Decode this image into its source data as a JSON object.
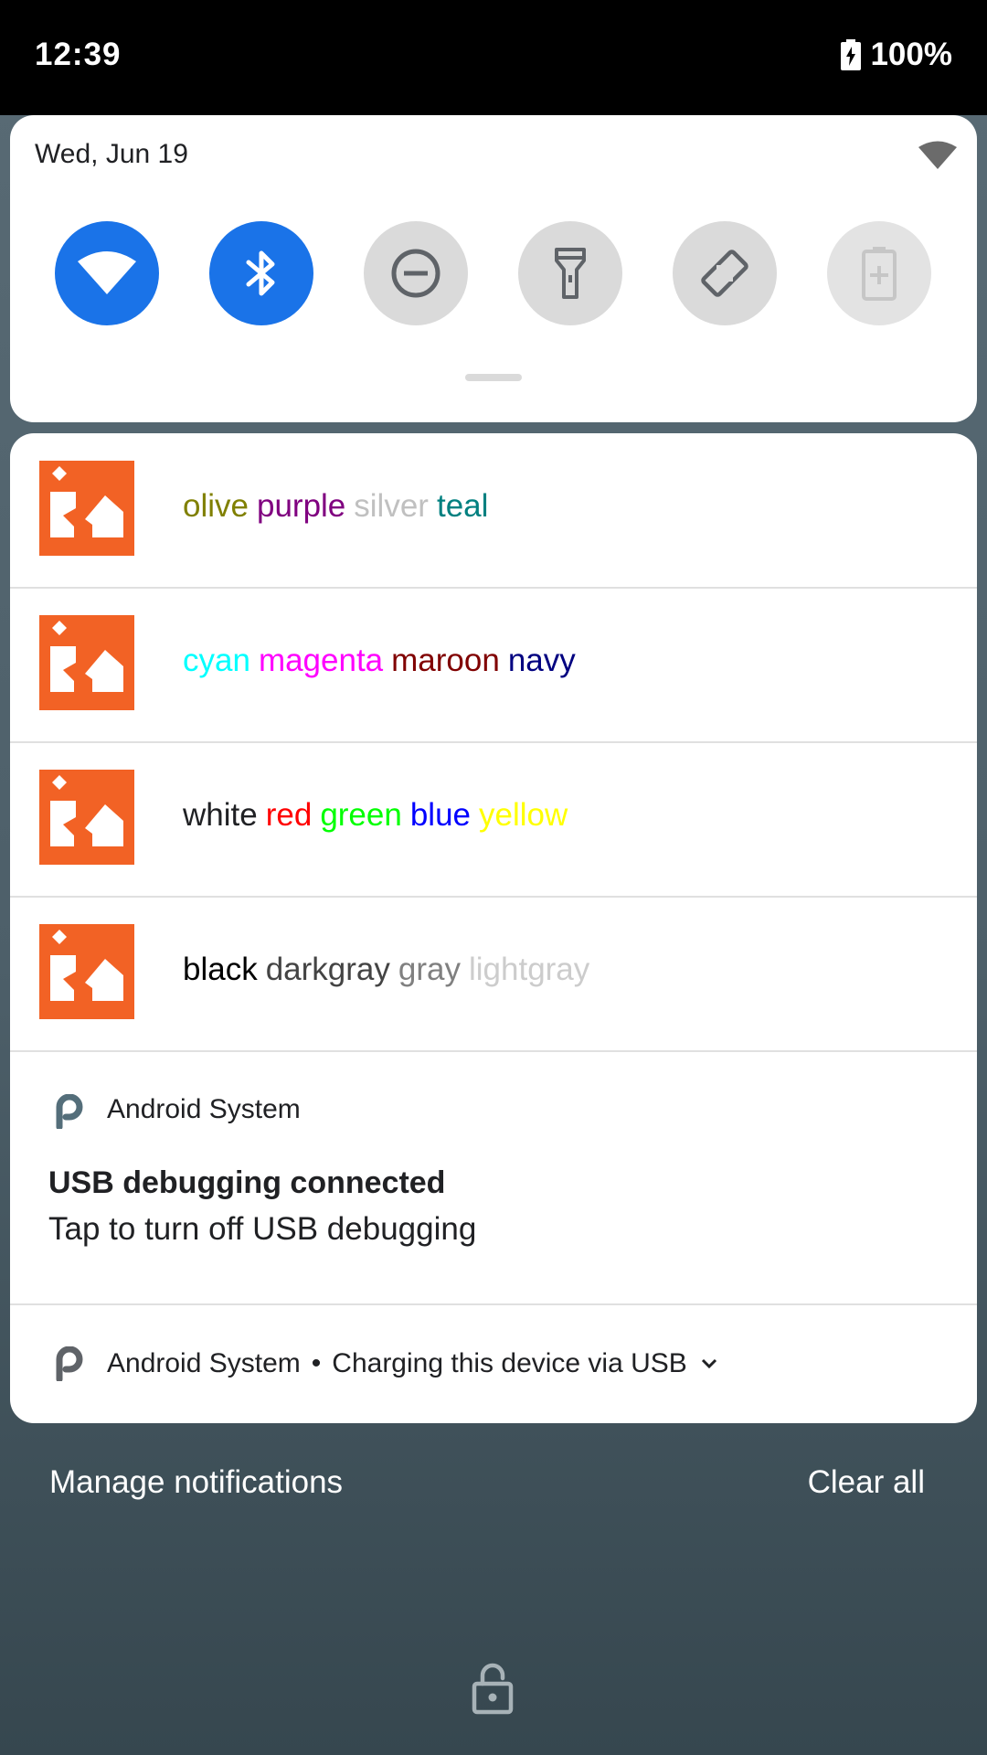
{
  "status_bar": {
    "time": "12:39",
    "battery": "100%"
  },
  "quick_settings": {
    "date": "Wed, Jun 19",
    "tiles": [
      {
        "icon": "wifi-icon",
        "state": "on"
      },
      {
        "icon": "bluetooth-icon",
        "state": "on"
      },
      {
        "icon": "do-not-disturb-icon",
        "state": "off"
      },
      {
        "icon": "flashlight-icon",
        "state": "off"
      },
      {
        "icon": "auto-rotate-icon",
        "state": "off"
      },
      {
        "icon": "battery-saver-icon",
        "state": "unavailable"
      }
    ]
  },
  "notifications": [
    {
      "words": [
        {
          "text": "olive",
          "color": "#808000"
        },
        {
          "text": "purple",
          "color": "#800080"
        },
        {
          "text": "silver",
          "color": "#c0c0c0"
        },
        {
          "text": "teal",
          "color": "#008080"
        }
      ]
    },
    {
      "words": [
        {
          "text": "cyan",
          "color": "#00ffff"
        },
        {
          "text": "magenta",
          "color": "#ff00ff"
        },
        {
          "text": "maroon",
          "color": "#800000"
        },
        {
          "text": "navy",
          "color": "#000080"
        }
      ]
    },
    {
      "words": [
        {
          "text": "white",
          "color": "#202124"
        },
        {
          "text": "red",
          "color": "#ff0000"
        },
        {
          "text": "green",
          "color": "#00ff00"
        },
        {
          "text": "blue",
          "color": "#0000ff"
        },
        {
          "text": "yellow",
          "color": "#ffff00"
        }
      ]
    },
    {
      "words": [
        {
          "text": "black",
          "color": "#000000"
        },
        {
          "text": "darkgray",
          "color": "#444444"
        },
        {
          "text": "gray",
          "color": "#808080"
        },
        {
          "text": "lightgray",
          "color": "#cccccc"
        }
      ]
    }
  ],
  "system_notification": {
    "app": "Android System",
    "title": "USB debugging connected",
    "text": "Tap to turn off USB debugging"
  },
  "system_notification_2": {
    "app": "Android System",
    "separator": "•",
    "text": "Charging this device via USB"
  },
  "footer": {
    "manage": "Manage notifications",
    "clear": "Clear all"
  },
  "colors": {
    "accent": "#1a73e8",
    "app_icon": "#f26225"
  }
}
